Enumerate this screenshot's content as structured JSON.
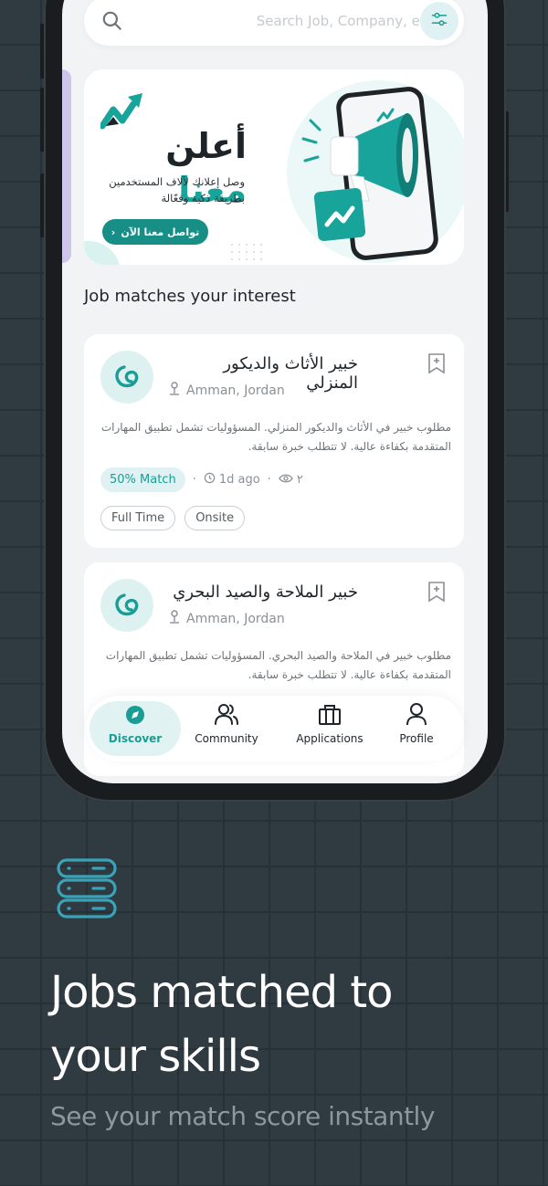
{
  "search": {
    "placeholder": "Search Job, Company, etc"
  },
  "banner": {
    "title_part1": "أعلن",
    "title_part2": "معنا",
    "subtitle_line1": "وصل إعلانك لآلاف المستخدمين",
    "subtitle_line2": "بطريقة ذكية وفعّالة",
    "cta_label": "تواصل معنا الآن"
  },
  "section": {
    "title": "Job matches your interest"
  },
  "jobs": [
    {
      "title": "خبير الأثاث والديكور المنزلي",
      "location": "Amman, Jordan",
      "description": "مطلوب خبير في الأثاث والديكور المنزلي. المسؤوليات تشمل تطبيق المهارات المتقدمة بكفاءة عالية. لا تتطلب خبرة سابقة.",
      "match": "50% Match",
      "posted": "1d ago",
      "views": "٢",
      "tags": [
        "Full Time",
        "Onsite"
      ]
    },
    {
      "title": "خبير الملاحة والصيد البحري",
      "location": "Amman, Jordan",
      "description": "مطلوب خبير في الملاحة والصيد البحري. المسؤوليات تشمل تطبيق المهارات المتقدمة بكفاءة عالية. لا تتطلب خبرة سابقة."
    }
  ],
  "nav": {
    "items": [
      {
        "label": "Discover",
        "icon": "compass-icon",
        "active": true
      },
      {
        "label": "Community",
        "icon": "people-icon"
      },
      {
        "label": "Applications",
        "icon": "briefcase-icon"
      },
      {
        "label": "Profile",
        "icon": "person-icon"
      }
    ]
  },
  "promo": {
    "headline_line1": "Jobs matched to",
    "headline_line2": "your skills",
    "subline": "See your match score instantly"
  },
  "colors": {
    "accent": "#1a9d95",
    "background": "#2f3a41",
    "feature_icon": "#3ba3b8"
  }
}
